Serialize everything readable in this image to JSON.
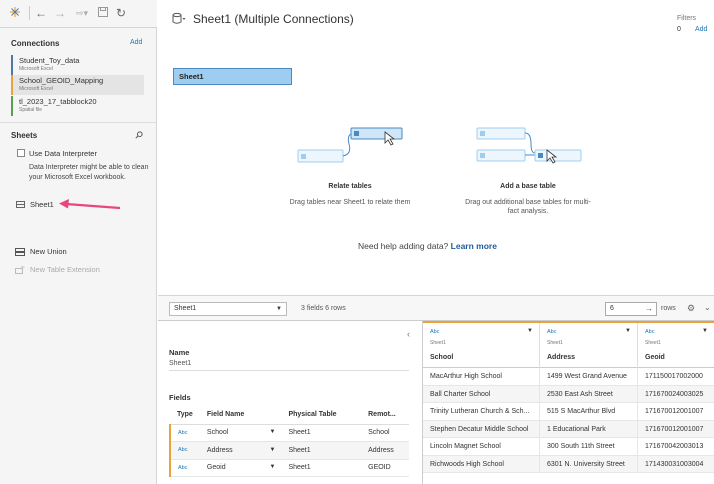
{
  "toolbar": {
    "logo_icon": "tableau-logo-icon",
    "back_icon": "back-arrow-icon",
    "forward_icon": "forward-arrow-icon",
    "connect_icon": "connect-data-icon",
    "save_icon": "save-icon",
    "refresh_icon": "refresh-icon"
  },
  "connections": {
    "header": "Connections",
    "add_label": "Add",
    "items": [
      {
        "name": "Student_Toy_data",
        "type": "Microsoft Excel",
        "color": "#4e79a7"
      },
      {
        "name": "School_GEOID_Mapping",
        "type": "Microsoft Excel",
        "color": "#e8a33d"
      },
      {
        "name": "tl_2023_17_tabblock20",
        "type": "Spatial file",
        "color": "#59a14f"
      }
    ]
  },
  "sheets": {
    "header": "Sheets",
    "search_icon": "search-icon",
    "use_interpreter_label": "Use Data Interpreter",
    "interpreter_note": "Data Interpreter might be able to clean your Microsoft Excel workbook.",
    "sheet_items": [
      {
        "label": "Sheet1",
        "icon": "sheet-icon"
      }
    ],
    "new_union_label": "New Union",
    "new_table_extension_label": "New Table Extension"
  },
  "canvas": {
    "title": "Sheet1 (Multiple Connections)",
    "filters_label": "Filters",
    "filters_count": "0",
    "filters_add": "Add",
    "sheet_block_label": "Sheet1",
    "relate": {
      "title": "Relate tables",
      "description": "Drag tables near Sheet1 to relate them"
    },
    "base": {
      "title": "Add a base table",
      "description": "Drag out additional base tables for multi-fact analysis."
    },
    "help_text": "Need help adding data?",
    "help_link": "Learn more"
  },
  "bottom": {
    "table_select": "Sheet1",
    "info": "3 fields 6 rows",
    "rows_value": "6",
    "rows_label": "rows",
    "name_label": "Name",
    "name_value": "Sheet1",
    "fields_label": "Fields",
    "fields_columns": [
      "Type",
      "Field Name",
      "Physical Table",
      "Remot..."
    ],
    "fields": [
      {
        "type": "Abc",
        "name": "School",
        "table": "Sheet1",
        "remote": "School"
      },
      {
        "type": "Abc",
        "name": "Address",
        "table": "Sheet1",
        "remote": "Address"
      },
      {
        "type": "Abc",
        "name": "Geoid",
        "table": "Sheet1",
        "remote": "GEOID"
      }
    ],
    "grid_columns": [
      {
        "type": "Abc",
        "source": "Sheet1",
        "name": "School"
      },
      {
        "type": "Abc",
        "source": "Sheet1",
        "name": "Address"
      },
      {
        "type": "Abc",
        "source": "Sheet1",
        "name": "Geoid"
      }
    ],
    "grid_rows": [
      [
        "MacArthur High School",
        "1499 West Grand Avenue",
        "171150017002000"
      ],
      [
        "Ball Charter School",
        "2530 East Ash Street",
        "171670024003025"
      ],
      [
        "Trinity Lutheran Church & Sch...",
        "515 S MacArthur Blvd",
        "171670012001007"
      ],
      [
        "Stephen Decatur Middle School",
        "1 Educational Park",
        "171670012001007"
      ],
      [
        "Lincoln Magnet School",
        "300 South 11th Street",
        "171670042003013"
      ],
      [
        "Richwoods High School",
        "6301 N. University Street",
        "171430031003004"
      ]
    ]
  },
  "colors": {
    "accent": "#1f77b4",
    "sheet_block": "#9fcdf0",
    "arrow": "#e8467c",
    "orange_rule": "#e8a33d"
  }
}
